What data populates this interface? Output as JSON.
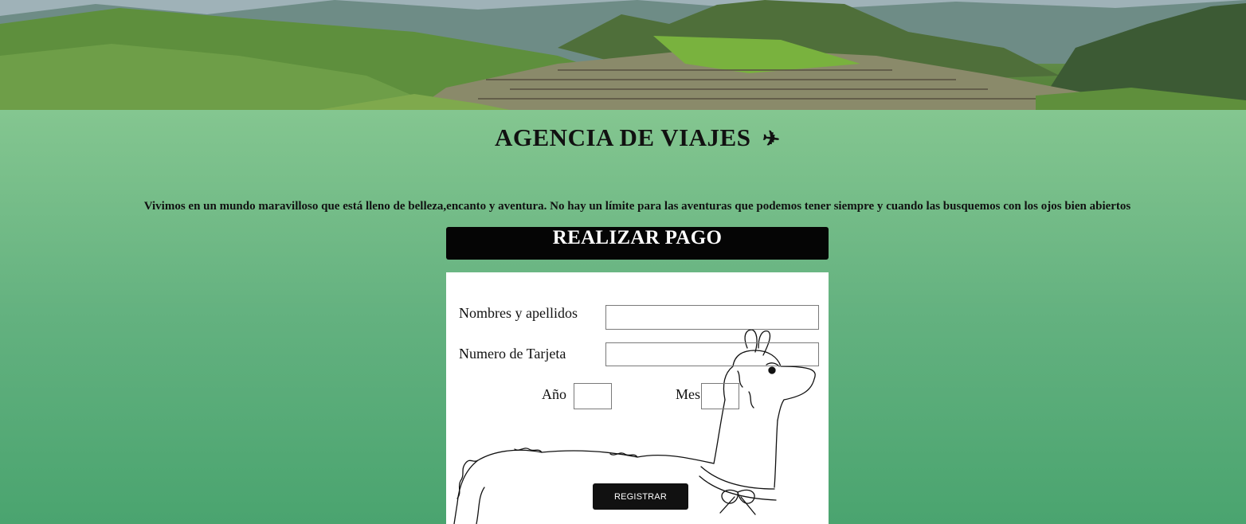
{
  "header": {
    "banner_image": "mountain-ruins-landscape",
    "title": "AGENCIA DE VIAJES",
    "title_icon": "airplane-icon",
    "tagline": "Vivimos en un mundo maravilloso que está lleno de belleza,encanto y aventura. No hay un límite para las aventuras que podemos tener siempre y cuando las busquemos con los ojos bien abiertos"
  },
  "payment": {
    "heading": "REALIZAR PAGO",
    "background_image": "llama-line-drawing",
    "fields": {
      "name_label": "Nombres y apellidos",
      "name_value": "",
      "card_label": "Numero de Tarjeta",
      "card_value": "",
      "year_label": "Año",
      "year_value": "",
      "month_label": "Mes",
      "month_value": ""
    },
    "submit_label": "REGISTRAR"
  },
  "colors": {
    "page_background_top": "#84c690",
    "page_background_bottom": "#4aa46f",
    "header_bar": "#050505",
    "button": "#111111"
  }
}
